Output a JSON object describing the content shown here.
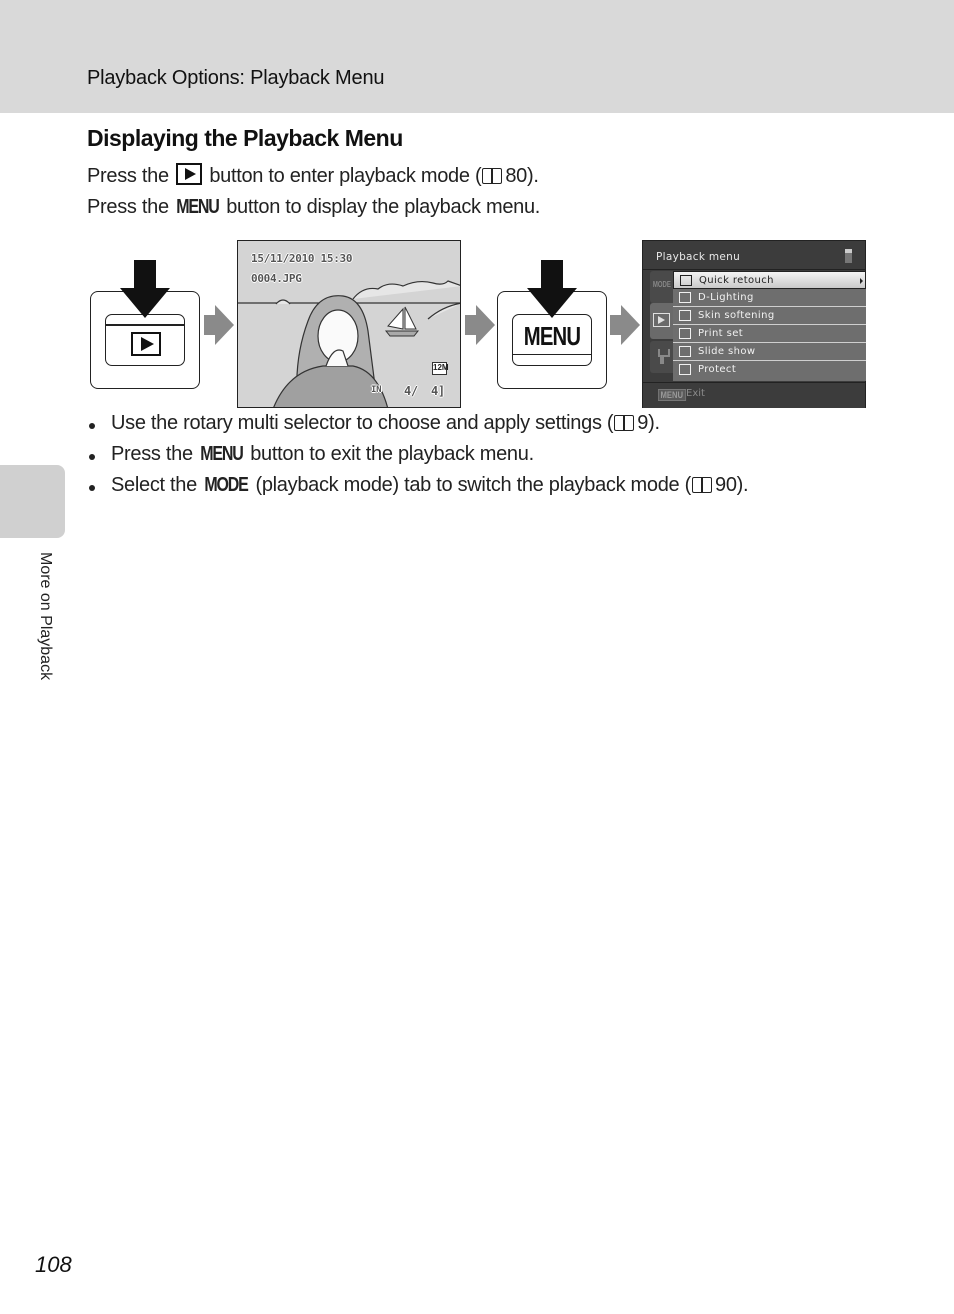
{
  "header": {
    "running_title": "Playback Options: Playback Menu"
  },
  "section": {
    "title": "Displaying the Playback Menu",
    "step1": {
      "before": "Press the",
      "icon": "playback-button-icon",
      "after": "button to enter playback mode (",
      "ref_icon": "book-reference-icon",
      "ref_page": "80",
      "close": ")."
    },
    "step2": {
      "before": "Press the",
      "button": "MENU",
      "after": "button to display the playback menu."
    }
  },
  "diagram": {
    "menu_button_label": "MENU",
    "playback_screen": {
      "date_time": "15/11/2010 15:30",
      "file_name": "0004.JPG",
      "image_size_badge": "12M",
      "memory_indicator": "IN",
      "frame_number": "4/",
      "total_frames": "4]"
    },
    "camera_menu": {
      "title": "Playback menu",
      "tabs": [
        {
          "name": "MODE",
          "icon": "mode-tab"
        },
        {
          "name": "Playback",
          "icon": "playback-tab-icon",
          "active": true
        },
        {
          "name": "Setup",
          "icon": "wrench-icon"
        }
      ],
      "items": [
        {
          "label": "Quick retouch",
          "icon": "quick-retouch-icon",
          "selected": true
        },
        {
          "label": "D-Lighting",
          "icon": "d-lighting-icon"
        },
        {
          "label": "Skin softening",
          "icon": "skin-softening-icon"
        },
        {
          "label": "Print set",
          "icon": "printer-icon"
        },
        {
          "label": "Slide show",
          "icon": "slide-show-icon"
        },
        {
          "label": "Protect",
          "icon": "key-icon"
        }
      ],
      "footer_button": "MENU",
      "footer_label": "Exit"
    }
  },
  "bullets": [
    {
      "text_before": "Use the rotary multi selector to choose and apply settings (",
      "ref_page": "9",
      "text_after": ")."
    },
    {
      "text_before": "Press the",
      "button": "MENU",
      "text_after": "button to exit the playback menu."
    },
    {
      "text_before": "Select the",
      "button": "MODE",
      "text_after": "(playback mode) tab to switch the playback mode (",
      "ref_page": "90",
      "close": ")."
    }
  ],
  "side_tab": {
    "label": "More on Playback"
  },
  "page_number": "108"
}
